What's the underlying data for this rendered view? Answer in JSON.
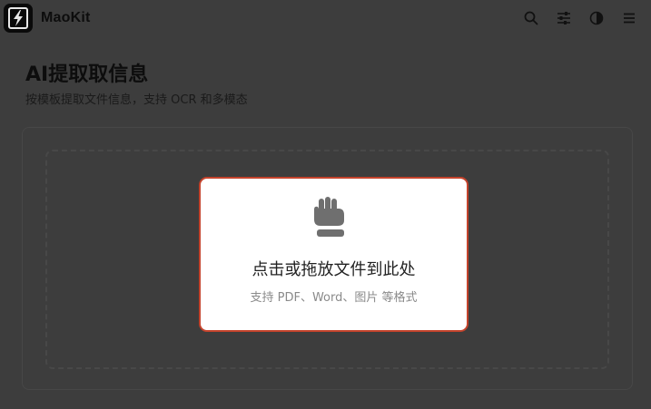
{
  "app": {
    "brand": "MaoKit",
    "logo_icon": "lightning-bolt-icon"
  },
  "topbar": {
    "icons": [
      {
        "name": "search-icon"
      },
      {
        "name": "sliders-icon"
      },
      {
        "name": "theme-contrast-icon"
      },
      {
        "name": "menu-icon"
      }
    ]
  },
  "page": {
    "title": "AI提取取信息",
    "subtitle": "按模板提取文件信息，支持 OCR 和多模态"
  },
  "upload": {
    "icon": "grab-hand-icon",
    "title": "点击或拖放文件到此处",
    "hint": "支持 PDF、Word、图片 等格式",
    "accent_color": "#c4432c"
  }
}
